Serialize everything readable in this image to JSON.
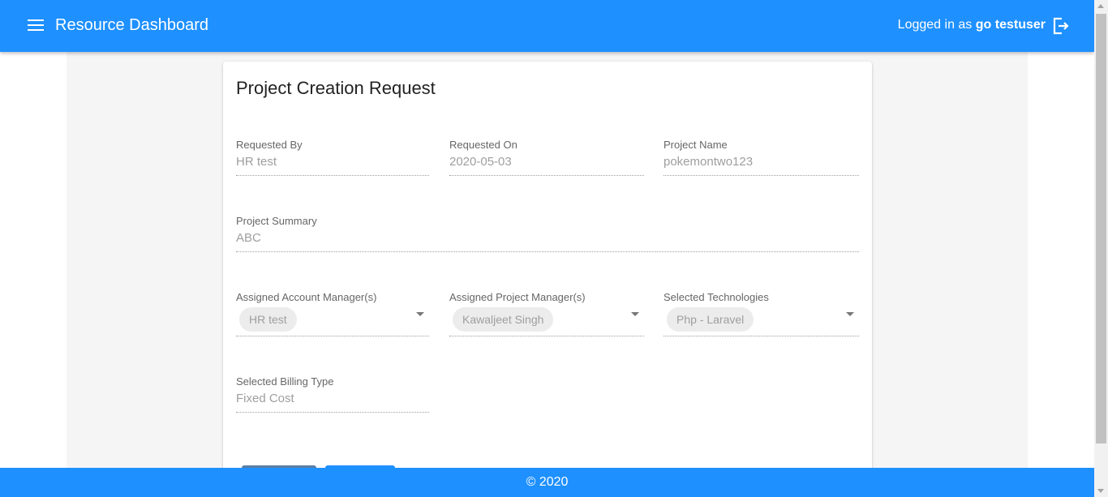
{
  "header": {
    "title": "Resource Dashboard",
    "login_prefix": "Logged in as ",
    "username": "go testuser"
  },
  "form": {
    "title": "Project Creation Request",
    "requested_by": {
      "label": "Requested By",
      "value": "HR test"
    },
    "requested_on": {
      "label": "Requested On",
      "value": "2020-05-03"
    },
    "project_name": {
      "label": "Project Name",
      "value": "pokemontwo123"
    },
    "project_summary": {
      "label": "Project Summary",
      "value": "ABC"
    },
    "account_managers": {
      "label": "Assigned Account Manager(s)",
      "chip": "HR test"
    },
    "project_managers": {
      "label": "Assigned Project Manager(s)",
      "chip": "Kawaljeet Singh"
    },
    "technologies": {
      "label": "Selected Technologies",
      "chip": "Php - Laravel"
    },
    "billing_type": {
      "label": "Selected Billing Type",
      "value": "Fixed Cost"
    }
  },
  "footer": {
    "text": "© 2020"
  },
  "colors": {
    "primary": "#1e90ff",
    "button_secondary": "#5a7ea6"
  }
}
